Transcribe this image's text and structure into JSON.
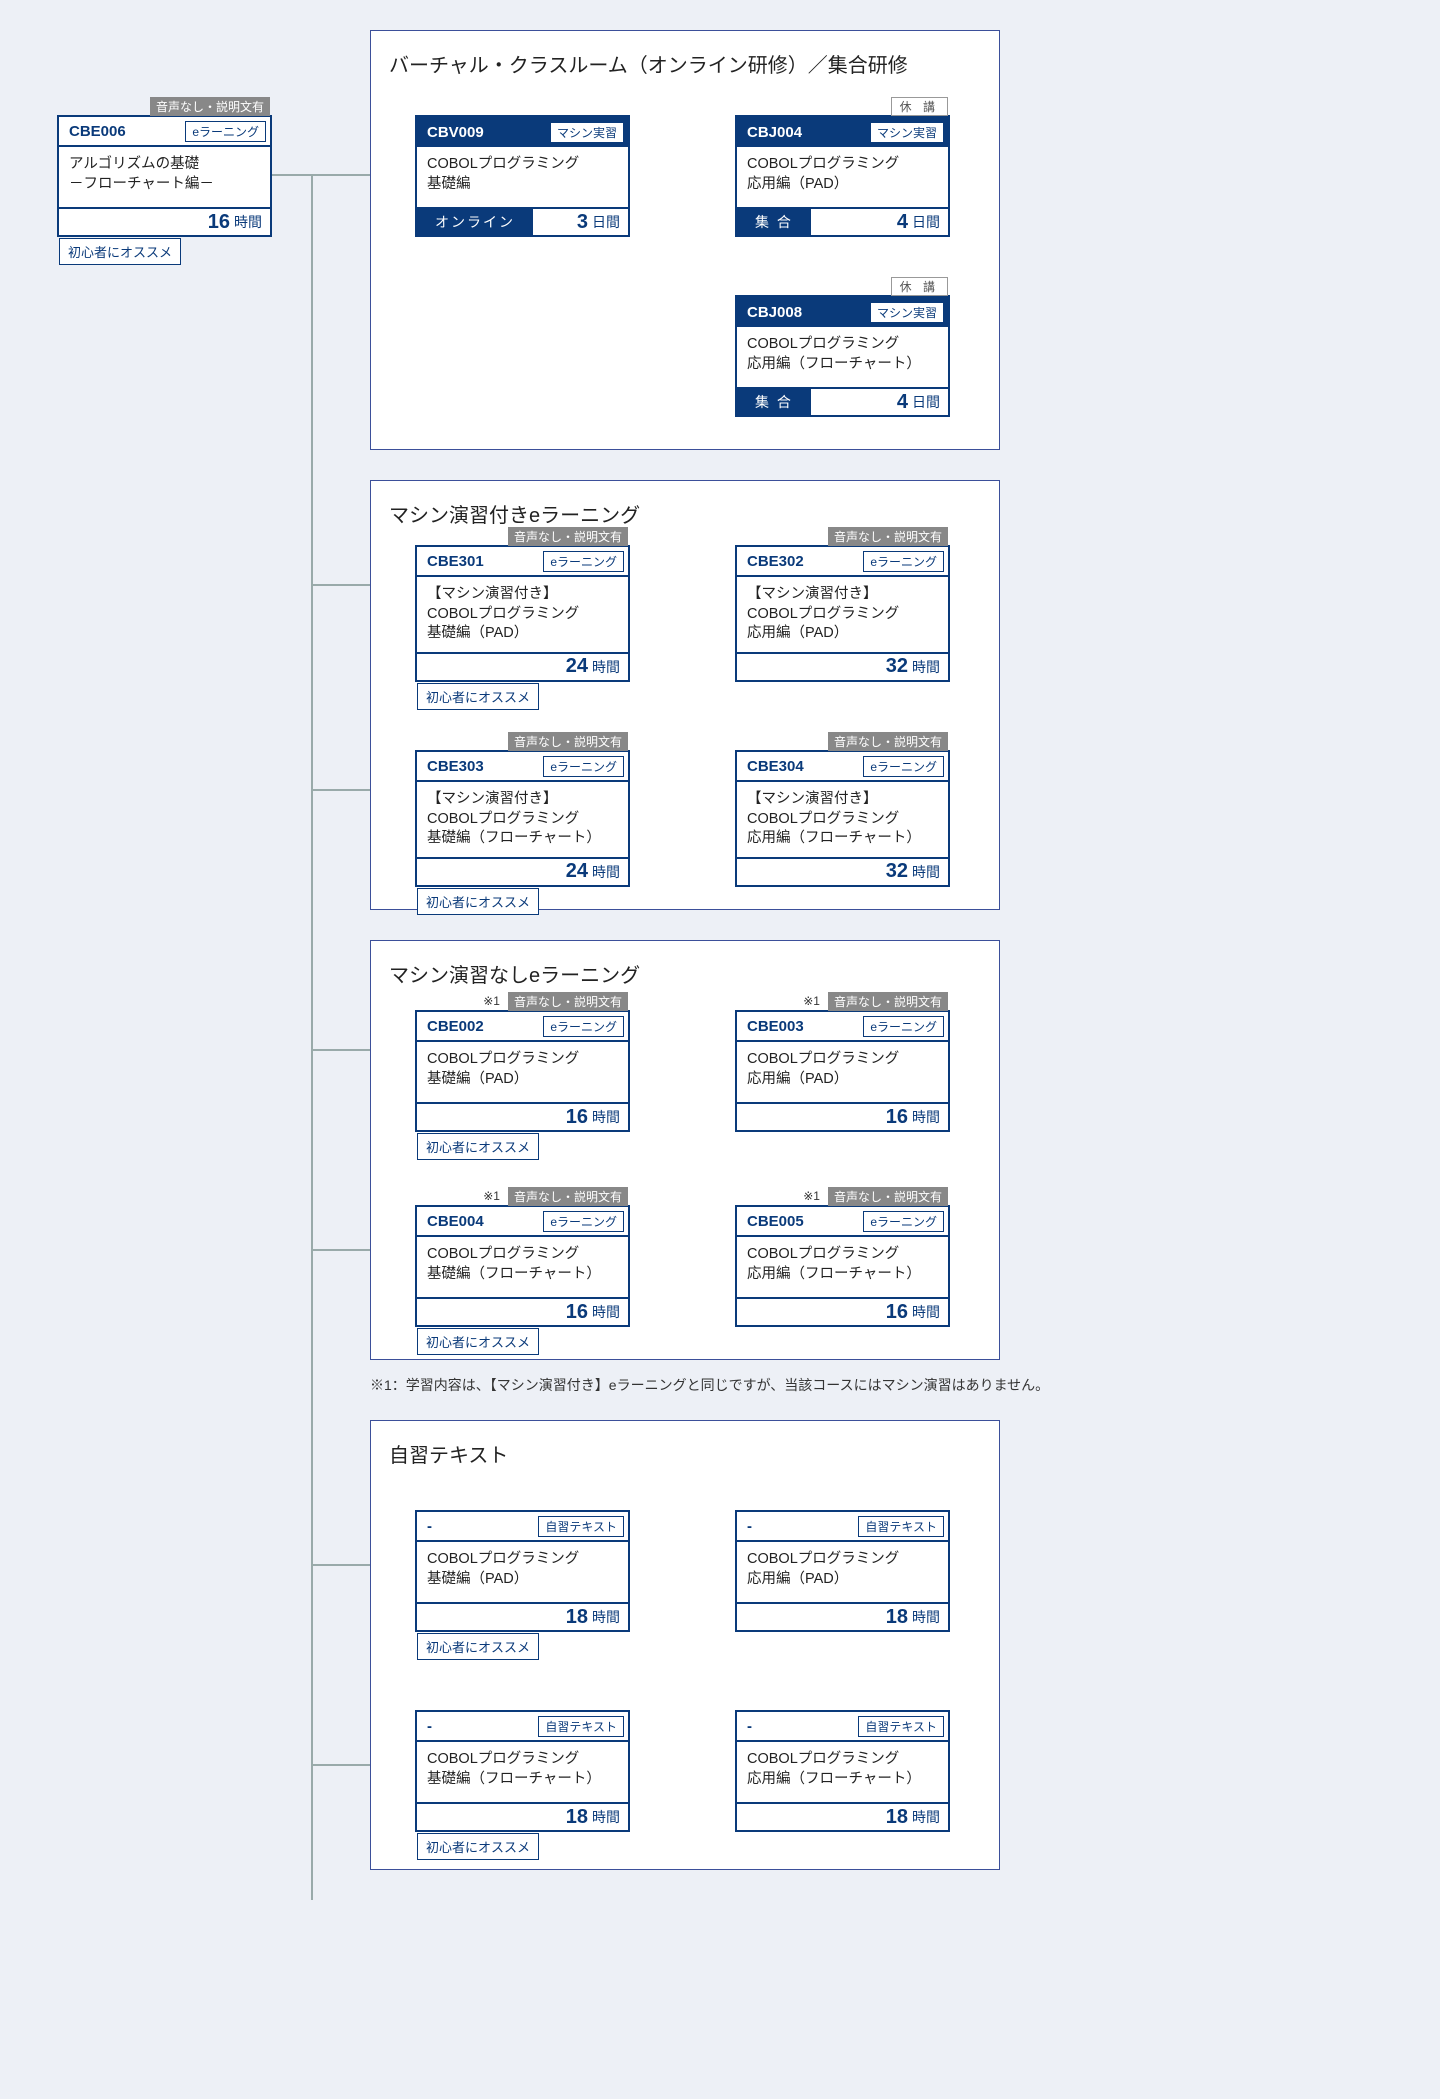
{
  "labels": {
    "audio_note": "音声なし・説明文有",
    "suspended": "休 講",
    "star1": "※1",
    "beginner": "初心者にオススメ"
  },
  "sections": {
    "s1": {
      "title": "バーチャル・クラスルーム（オンライン研修）／集合研修"
    },
    "s2": {
      "title": "マシン演習付きeラーニング"
    },
    "s3": {
      "title": "マシン演習なしeラーニング"
    },
    "s4": {
      "title": "自習テキスト"
    }
  },
  "cards": {
    "cbe006": {
      "code": "CBE006",
      "tag": "eラーニング",
      "title": "アルゴリズムの基礎\n－フローチャート編－",
      "dur_num": "16",
      "dur_unit": "時間"
    },
    "cbv009": {
      "code": "CBV009",
      "tag": "マシン実習",
      "title": "COBOLプログラミング\n基礎編",
      "mode": "オンライン",
      "dur_num": "3",
      "dur_unit": "日間"
    },
    "cbj004": {
      "code": "CBJ004",
      "tag": "マシン実習",
      "title": "COBOLプログラミング\n応用編（PAD）",
      "mode": "集 合",
      "dur_num": "4",
      "dur_unit": "日間"
    },
    "cbj008": {
      "code": "CBJ008",
      "tag": "マシン実習",
      "title": "COBOLプログラミング\n応用編（フローチャート）",
      "mode": "集 合",
      "dur_num": "4",
      "dur_unit": "日間"
    },
    "cbe301": {
      "code": "CBE301",
      "tag": "eラーニング",
      "title": "【マシン演習付き】\nCOBOLプログラミング\n基礎編（PAD）",
      "dur_num": "24",
      "dur_unit": "時間"
    },
    "cbe302": {
      "code": "CBE302",
      "tag": "eラーニング",
      "title": "【マシン演習付き】\nCOBOLプログラミング\n応用編（PAD）",
      "dur_num": "32",
      "dur_unit": "時間"
    },
    "cbe303": {
      "code": "CBE303",
      "tag": "eラーニング",
      "title": "【マシン演習付き】\nCOBOLプログラミング\n基礎編（フローチャート）",
      "dur_num": "24",
      "dur_unit": "時間"
    },
    "cbe304": {
      "code": "CBE304",
      "tag": "eラーニング",
      "title": "【マシン演習付き】\nCOBOLプログラミング\n応用編（フローチャート）",
      "dur_num": "32",
      "dur_unit": "時間"
    },
    "cbe002": {
      "code": "CBE002",
      "tag": "eラーニング",
      "title": "COBOLプログラミング\n基礎編（PAD）",
      "dur_num": "16",
      "dur_unit": "時間"
    },
    "cbe003": {
      "code": "CBE003",
      "tag": "eラーニング",
      "title": "COBOLプログラミング\n応用編（PAD）",
      "dur_num": "16",
      "dur_unit": "時間"
    },
    "cbe004": {
      "code": "CBE004",
      "tag": "eラーニング",
      "title": "COBOLプログラミング\n基礎編（フローチャート）",
      "dur_num": "16",
      "dur_unit": "時間"
    },
    "cbe005": {
      "code": "CBE005",
      "tag": "eラーニング",
      "title": "COBOLプログラミング\n応用編（フローチャート）",
      "dur_num": "16",
      "dur_unit": "時間"
    },
    "st1": {
      "code": "-",
      "tag": "自習テキスト",
      "title": "COBOLプログラミング\n基礎編（PAD）",
      "dur_num": "18",
      "dur_unit": "時間"
    },
    "st2": {
      "code": "-",
      "tag": "自習テキスト",
      "title": "COBOLプログラミング\n応用編（PAD）",
      "dur_num": "18",
      "dur_unit": "時間"
    },
    "st3": {
      "code": "-",
      "tag": "自習テキスト",
      "title": "COBOLプログラミング\n基礎編（フローチャート）",
      "dur_num": "18",
      "dur_unit": "時間"
    },
    "st4": {
      "code": "-",
      "tag": "自習テキスト",
      "title": "COBOLプログラミング\n応用編（フローチャート）",
      "dur_num": "18",
      "dur_unit": "時間"
    }
  },
  "footnote": "※1：学習内容は、【マシン演習付き】eラーニングと同じですが、当該コースにはマシン演習はありません。"
}
